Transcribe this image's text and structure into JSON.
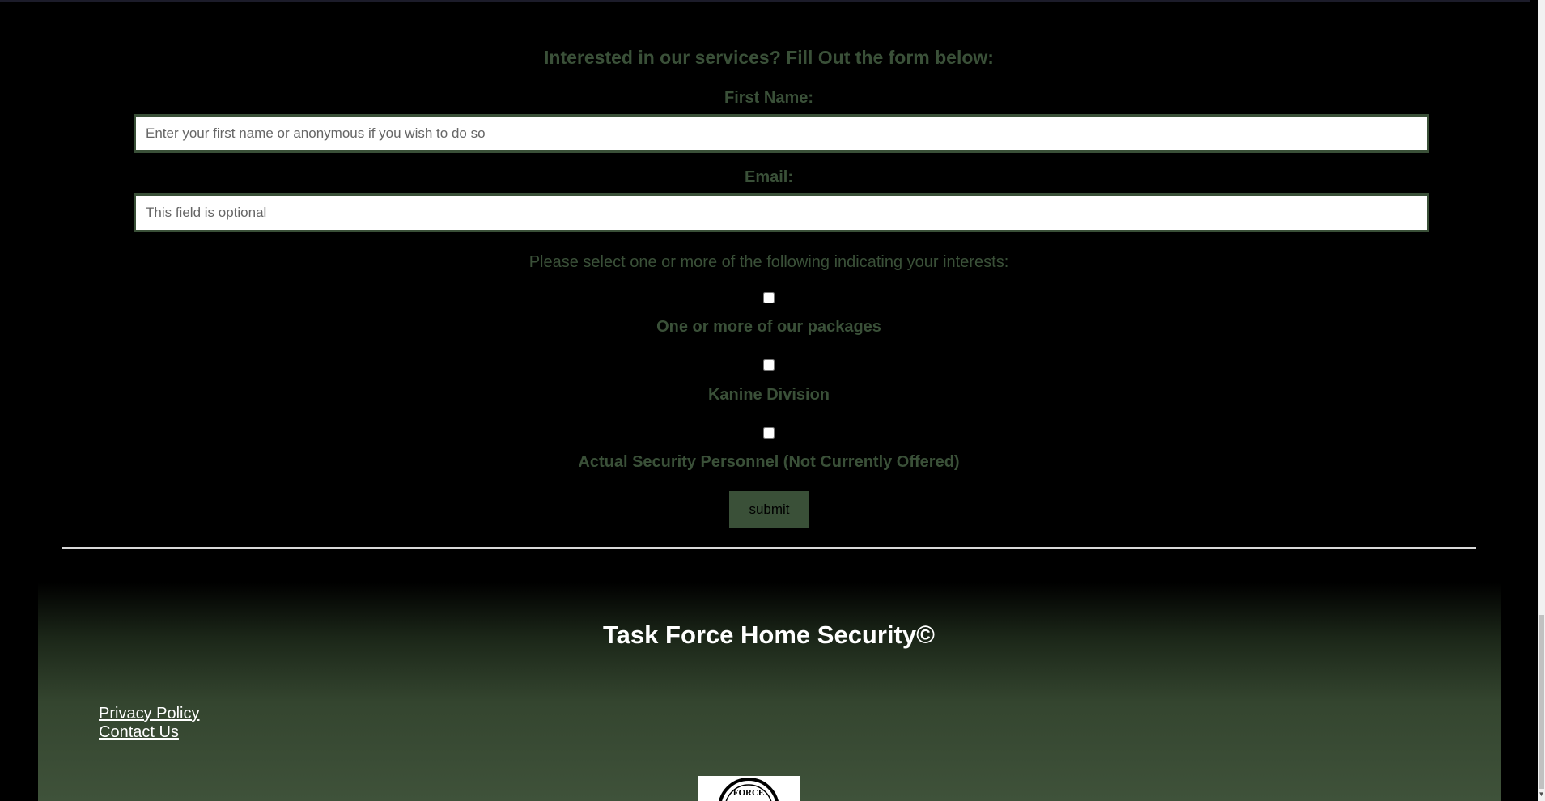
{
  "form": {
    "heading": "Interested in our services? Fill Out the form below:",
    "first_name_label": "First Name:",
    "first_name_placeholder": "Enter your first name or anonymous if you wish to do so",
    "email_label": "Email:",
    "email_placeholder": "This field is optional",
    "interests_prompt": "Please select one or more of the following indicating your interests:",
    "options": [
      {
        "label": "One or more of our packages",
        "checked": false
      },
      {
        "label": "Kanine Division",
        "checked": false
      },
      {
        "label": "Actual Security Personnel (Not Currently Offered)",
        "checked": false
      }
    ],
    "submit_label": "submit"
  },
  "footer": {
    "title": "Task Force Home Security©",
    "links": [
      "Privacy Policy",
      "Contact Us"
    ],
    "logo_text": "FORCE"
  },
  "colors": {
    "accent_green": "#3a5038",
    "background": "#000000",
    "footer_text": "#ffffff"
  },
  "icons": {
    "scroll_down": "chevron-down-icon"
  }
}
